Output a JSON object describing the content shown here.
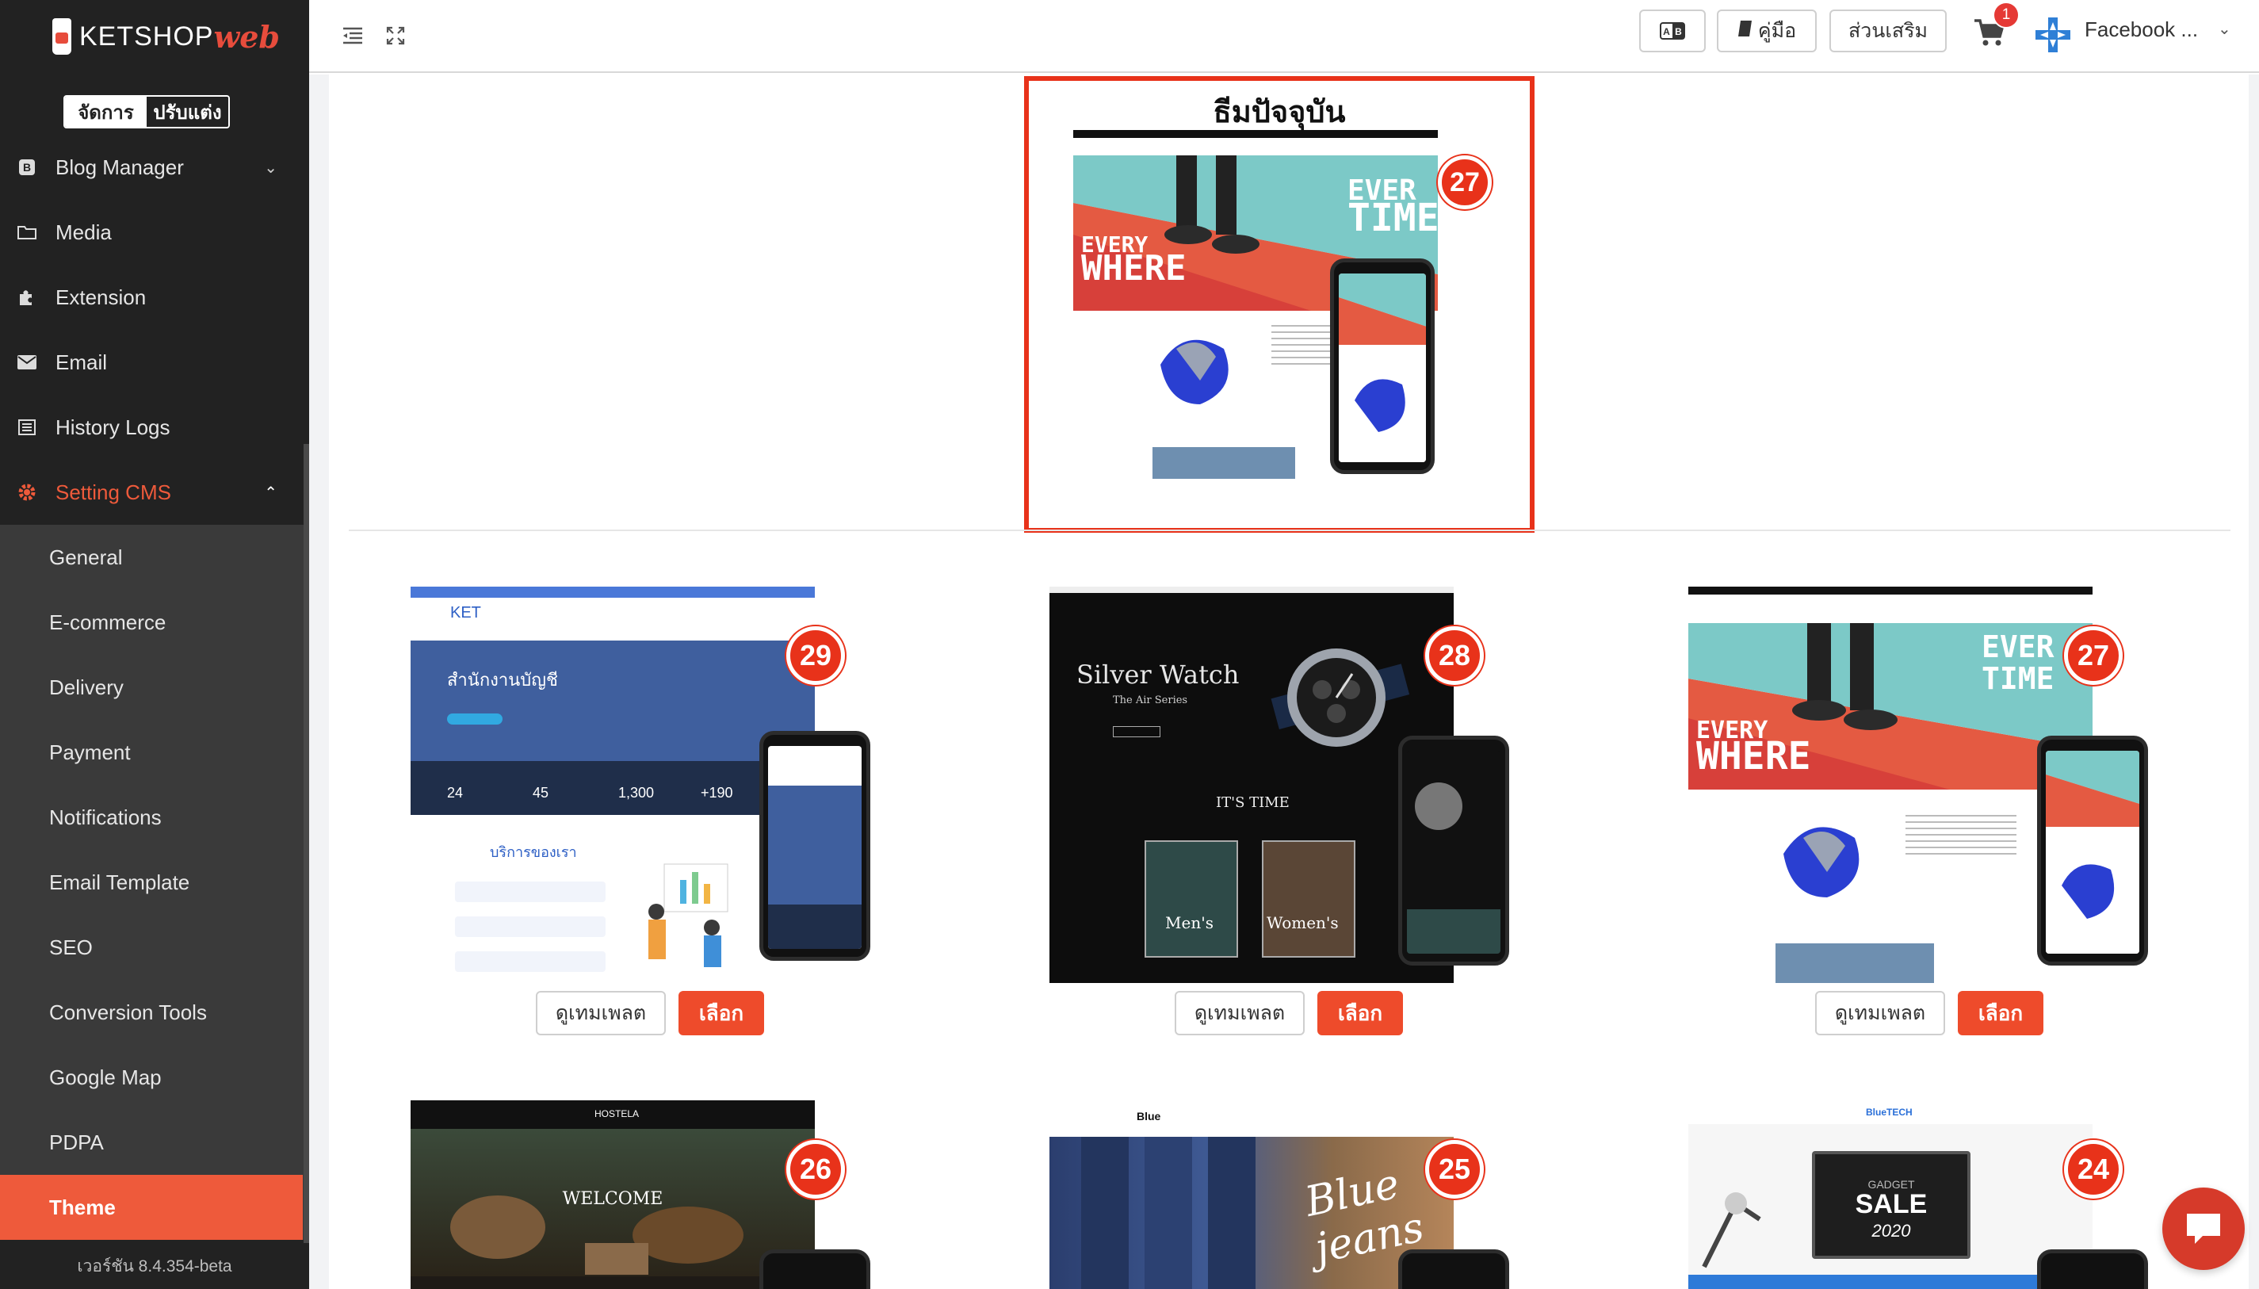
{
  "brand": {
    "name": "KETSHOP",
    "suffix": "web"
  },
  "mode": {
    "manage": "จัดการ",
    "customize": "ปรับแต่ง"
  },
  "nav": {
    "items": [
      {
        "label": "Blog Manager",
        "icon": "blog-icon"
      },
      {
        "label": "Media",
        "icon": "folder-icon"
      },
      {
        "label": "Extension",
        "icon": "puzzle-icon"
      },
      {
        "label": "Email",
        "icon": "envelope-icon"
      },
      {
        "label": "History Logs",
        "icon": "list-icon"
      },
      {
        "label": "Setting CMS",
        "icon": "gear-icon"
      }
    ],
    "sub_items": [
      {
        "label": "General"
      },
      {
        "label": "E-commerce"
      },
      {
        "label": "Delivery"
      },
      {
        "label": "Payment"
      },
      {
        "label": "Notifications"
      },
      {
        "label": "Email Template"
      },
      {
        "label": "SEO"
      },
      {
        "label": "Conversion Tools"
      },
      {
        "label": "Google Map"
      },
      {
        "label": "PDPA"
      },
      {
        "label": "Theme"
      }
    ],
    "version": "เวอร์ชัน 8.4.354-beta"
  },
  "topbar": {
    "language_icon": "language-icon",
    "manual_label": "คู่มือ",
    "addons_label": "ส่วนเสริม",
    "cart_count": "1",
    "account_name": "Facebook ..."
  },
  "current_theme": {
    "title": "ธีมปัจจุบัน",
    "number": "27",
    "hero_line1": "EVER",
    "hero_line2": "TIME",
    "hero_line3": "EVERY",
    "hero_line4": "WHERE"
  },
  "themes": [
    {
      "number": "29",
      "headline": "สำนักงานบัญชี",
      "sub": "บริการของเรา",
      "brand": "KET",
      "stats": [
        "24",
        "45",
        "1,300",
        "+190"
      ],
      "preview_label": "ดูเทมเพลต",
      "select_label": "เลือก"
    },
    {
      "number": "28",
      "headline": "Silver Watch",
      "sub": "IT'S TIME",
      "brand": "The Air Series",
      "tiles": [
        "Men's",
        "Women's"
      ],
      "preview_label": "ดูเทมเพลต",
      "select_label": "เลือก"
    },
    {
      "number": "27",
      "headline": "EVERY",
      "sub": "WHERE",
      "brand": "EVER TIME",
      "preview_label": "ดูเทมเพลต",
      "select_label": "เลือก"
    },
    {
      "number": "26",
      "headline": "WELCOME",
      "brand": "HOSTELA"
    },
    {
      "number": "25",
      "headline": "Blue jeans",
      "brand": "Blue"
    },
    {
      "number": "24",
      "headline": "SALE",
      "sub": "GADGET",
      "year": "2020",
      "brand": "BlueTECH"
    }
  ],
  "colors": {
    "accent": "#ee4b2b",
    "sidebar": "#222222",
    "subnav": "#3a3a3a"
  }
}
